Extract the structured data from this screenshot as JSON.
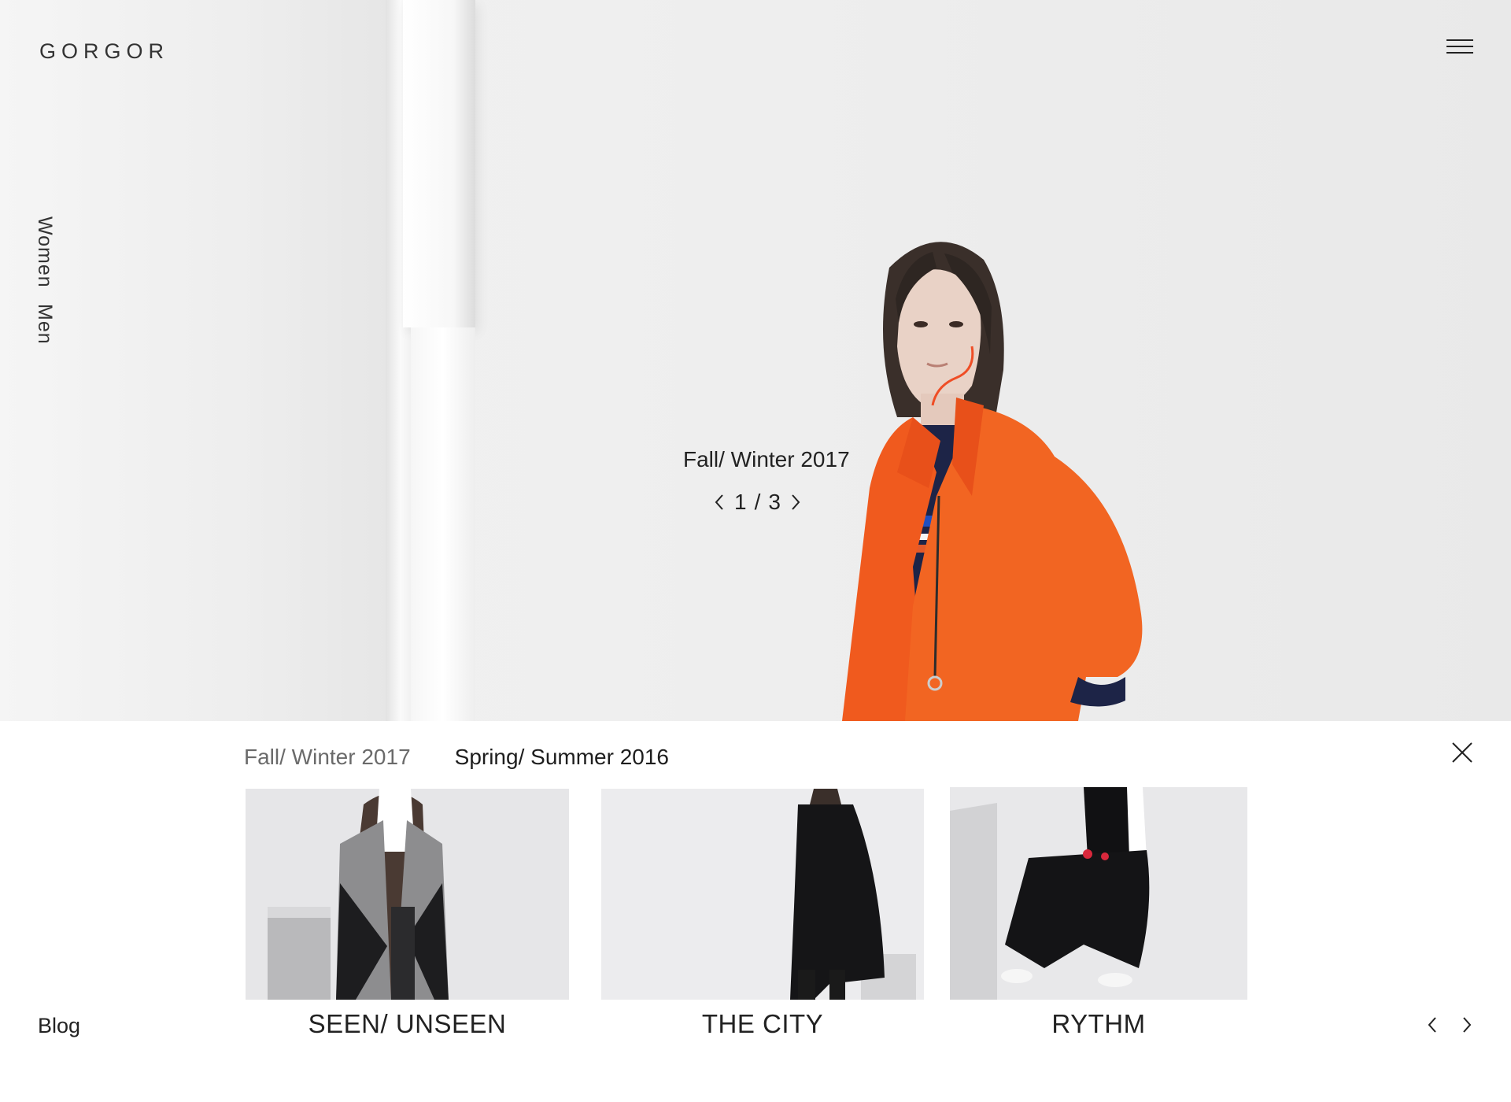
{
  "brand": {
    "logo_text": "GORGOR"
  },
  "header": {
    "menu_icon": "hamburger-menu-icon"
  },
  "side_nav": {
    "items": [
      "Women",
      "Men"
    ]
  },
  "hero": {
    "season_title": "Fall/ Winter 2017",
    "pager": {
      "current": "1",
      "separator": "/",
      "total": "3"
    }
  },
  "panel": {
    "tabs": [
      {
        "label": "Fall/ Winter 2017",
        "active": false
      },
      {
        "label": "Spring/ Summer 2016",
        "active": true
      }
    ],
    "cards": [
      {
        "caption": "SEEN/ UNSEEN"
      },
      {
        "caption": "THE CITY"
      },
      {
        "caption": "RYTHM"
      }
    ],
    "blog_label": "Blog"
  },
  "colors": {
    "text": "#1e1e1e",
    "muted_text": "#6a6a6a",
    "accent_coat": "#f05a1e",
    "background": "#ffffff",
    "hero_background": "#efefef"
  }
}
